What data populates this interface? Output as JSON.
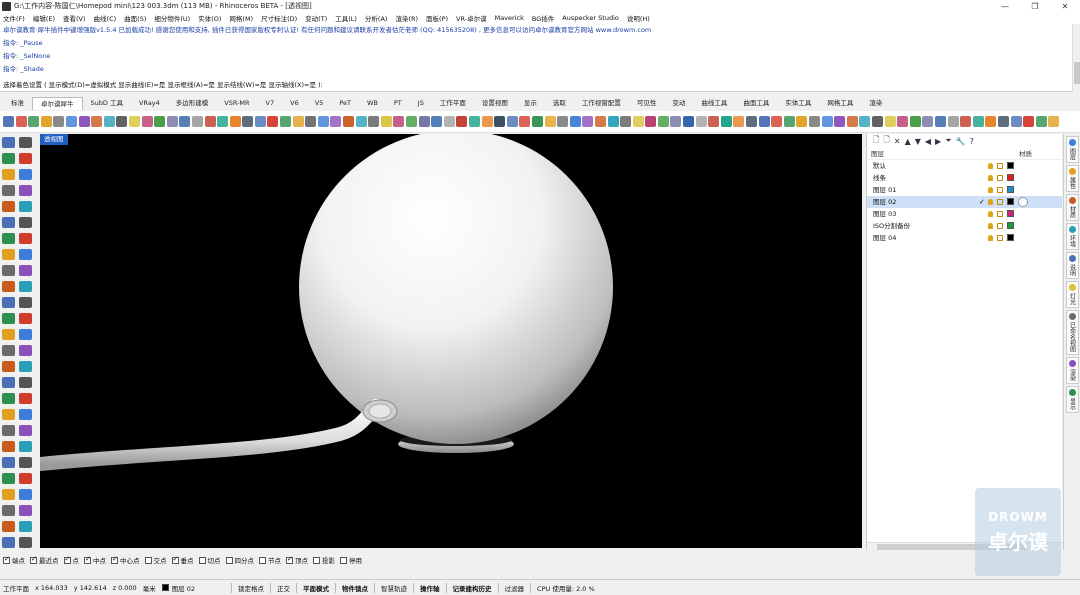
{
  "window": {
    "title": "G:\\工作内容-陈国仁\\Homepod mini\\123 003.3dm (113 MB) - Rhinoceros BETA - [透视图]",
    "controls": [
      "—",
      "❐",
      "✕"
    ]
  },
  "menubar": [
    "文件(F)",
    "编辑(E)",
    "查看(V)",
    "曲线(C)",
    "曲面(S)",
    "细分物件(U)",
    "实体(O)",
    "网格(M)",
    "尺寸标注(D)",
    "变动(T)",
    "工具(L)",
    "分析(A)",
    "渲染(R)",
    "面板(P)",
    "VR-卓尔谟",
    "Maverick",
    "BG插件",
    "Auspecker Studio",
    "说明(H)"
  ],
  "command_history": [
    {
      "text": "卓尔谟教育·犀牛插件中键增强版v1.5.4 已加载成功! 感谢您使用和支持, 插件已获得国家版权专利认证! 有任何问题和建议请联系开发者估茫老师 (QQ: 415635208) , 更多信息可以访问卓尔谟教育官方网站 www.drowm.com",
      "style": "blue"
    },
    {
      "text": "指令: _Pause",
      "style": "blue"
    },
    {
      "text": "指令: _SelNone",
      "style": "blue"
    },
    {
      "text": "指令: _Shade",
      "style": "blue"
    }
  ],
  "command_prompt": "选择着色设置 ( 显示模式(D)=虚拟模式  显示曲线(E)=是  显示框线(A)=是  显示结线(W)=是  显示轴线(X)=是 ):",
  "tabs": [
    {
      "label": "标准",
      "active": false
    },
    {
      "label": "卓尔谟犀牛",
      "active": true
    },
    {
      "label": "SubD 工具",
      "active": false
    },
    {
      "label": "VRay4",
      "active": false
    },
    {
      "label": "多边形建模",
      "active": false
    },
    {
      "label": "VSR-MR",
      "active": false
    },
    {
      "label": "V7",
      "active": false
    },
    {
      "label": "V6",
      "active": false
    },
    {
      "label": "V5",
      "active": false
    },
    {
      "label": "PeT",
      "active": false
    },
    {
      "label": "WB",
      "active": false
    },
    {
      "label": "PT",
      "active": false
    },
    {
      "label": "JS",
      "active": false
    },
    {
      "label": "工作平面",
      "active": false
    },
    {
      "label": "设置视图",
      "active": false
    },
    {
      "label": "显示",
      "active": false
    },
    {
      "label": "选取",
      "active": false
    },
    {
      "label": "工作视窗配置",
      "active": false
    },
    {
      "label": "可见性",
      "active": false
    },
    {
      "label": "变动",
      "active": false
    },
    {
      "label": "曲线工具",
      "active": false
    },
    {
      "label": "曲面工具",
      "active": false
    },
    {
      "label": "实体工具",
      "active": false
    },
    {
      "label": "网格工具",
      "active": false
    },
    {
      "label": "渲染",
      "active": false
    }
  ],
  "toolbar_colors": [
    "#4a6fb5",
    "#d23c2c",
    "#2f8f4f",
    "#e0a020",
    "#6b6b6b",
    "#3b7dd8",
    "#8a4fb8",
    "#c85a1e",
    "#2aa0b8",
    "#5a5a5a",
    "#d8c23a",
    "#b83a6a",
    "#3f9a3f",
    "#7070a0",
    "#2b5fa8",
    "#a0a0a0",
    "#c0392b",
    "#16a085",
    "#e67e22",
    "#34495e"
  ],
  "left_tool_colors": [
    "#4a6fb5",
    "#555",
    "#2f8f4f",
    "#d23c2c",
    "#e0a020",
    "#3b7dd8",
    "#6b6b6b",
    "#8a4fb8",
    "#c85a1e",
    "#2aa0b8"
  ],
  "viewport": {
    "label": "透视图"
  },
  "layers_panel": {
    "toolbar_icons": [
      "new-layer-icon",
      "new-sublayer-icon",
      "delete-icon",
      "move-up-icon",
      "move-down-icon",
      "move-left-icon",
      "move-right-icon",
      "filter-icon",
      "tools-icon",
      "help-icon"
    ],
    "toolbar_glyphs": [
      "🗋",
      "🗋",
      "✕",
      "▲",
      "▼",
      "◀",
      "▶",
      "⏷",
      "🔧",
      "?"
    ],
    "col_name": "图层",
    "col_material": "材质",
    "rows": [
      {
        "name": "默认",
        "color": "#000000",
        "current": false,
        "selected": false
      },
      {
        "name": "线条",
        "color": "#e02020",
        "current": false,
        "selected": false
      },
      {
        "name": "图层 01",
        "color": "#1e90c8",
        "current": false,
        "selected": false
      },
      {
        "name": "图层 02",
        "color": "#000000",
        "current": true,
        "selected": true,
        "check": "✓"
      },
      {
        "name": "图层 03",
        "color": "#d0207a",
        "current": false,
        "selected": false
      },
      {
        "name": "ISO分割备份",
        "color": "#1a9a3a",
        "current": false,
        "selected": false
      },
      {
        "name": "图层 04",
        "color": "#000000",
        "current": false,
        "selected": false
      }
    ]
  },
  "right_tabs": [
    {
      "label": "图层",
      "color": "#3b7dd8"
    },
    {
      "label": "属性",
      "color": "#e0a020"
    },
    {
      "label": "材质",
      "color": "#c85a1e"
    },
    {
      "label": "环境",
      "color": "#2aa0b8"
    },
    {
      "label": "说明",
      "color": "#4a6fb5"
    },
    {
      "label": "灯光",
      "color": "#d8c23a"
    },
    {
      "label": "已命名视图",
      "color": "#6b6b6b"
    },
    {
      "label": "渲染",
      "color": "#8a4fb8"
    },
    {
      "label": "显示",
      "color": "#2f8f4f"
    }
  ],
  "osnaps": [
    {
      "label": "端点",
      "on": true
    },
    {
      "label": "最近点",
      "on": true
    },
    {
      "label": "点",
      "on": true
    },
    {
      "label": "中点",
      "on": true
    },
    {
      "label": "中心点",
      "on": true
    },
    {
      "label": "交点",
      "on": false
    },
    {
      "label": "垂点",
      "on": true
    },
    {
      "label": "切点",
      "on": false
    },
    {
      "label": "四分点",
      "on": false
    },
    {
      "label": "节点",
      "on": false
    },
    {
      "label": "顶点",
      "on": true
    },
    {
      "label": "投影",
      "on": false
    },
    {
      "label": "停用",
      "on": false
    }
  ],
  "statusbar": {
    "cplane": "工作平面",
    "x": "x 164.033",
    "y": "y 142.614",
    "z": "z 0.000",
    "units": "毫米",
    "current_layer": "图层 02",
    "toggles": [
      "锁定格点",
      "正交",
      "平面模式",
      "物件锁点",
      "智慧轨迹",
      "操作轴",
      "记录建构历史",
      "过滤器"
    ],
    "active_toggles": [
      "平面模式",
      "物件锁点",
      "操作轴",
      "记录建构历史"
    ],
    "cpu": "CPU 使用量: 2.0 %"
  },
  "watermark": {
    "line1": "DROWM",
    "line2": "卓尔谟"
  }
}
